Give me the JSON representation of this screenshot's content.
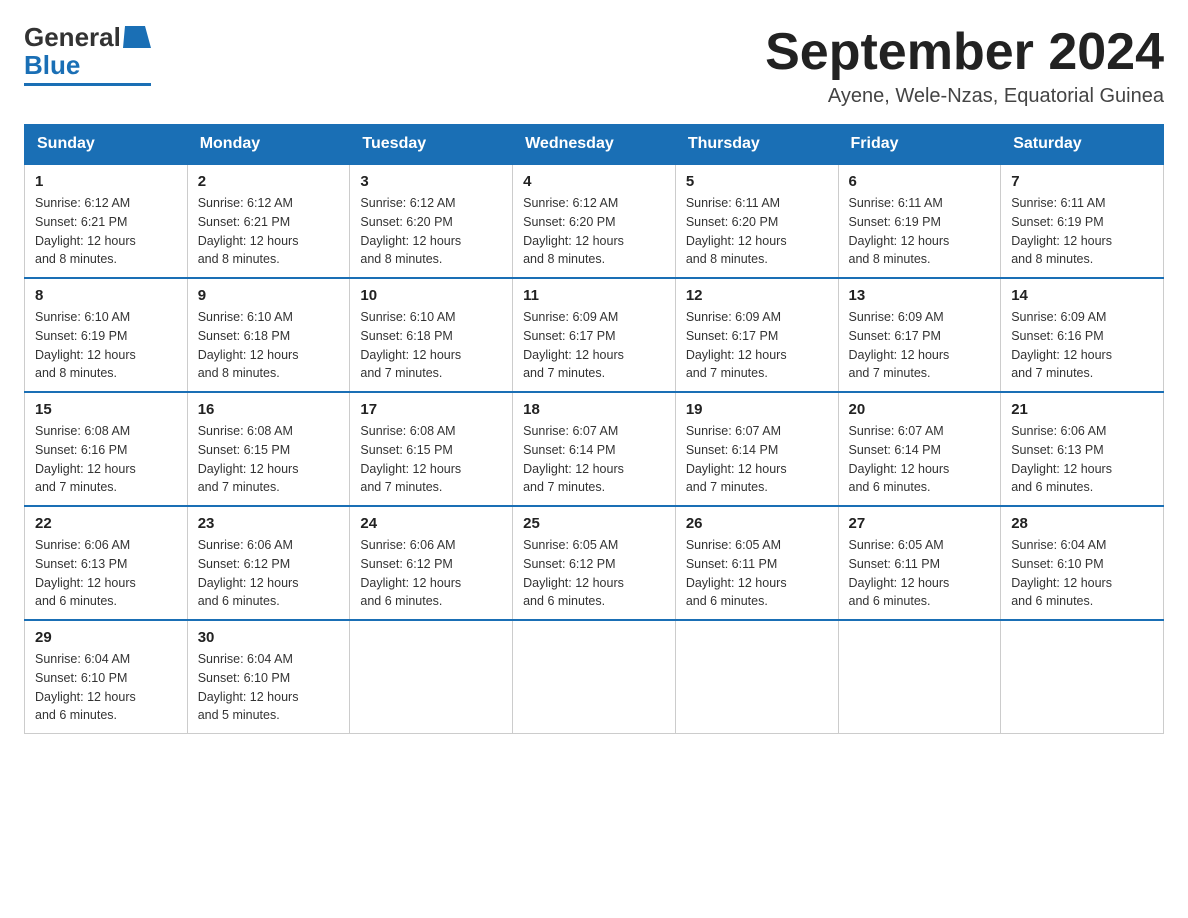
{
  "header": {
    "logo": {
      "text1": "General",
      "text2": "Blue"
    },
    "title": "September 2024",
    "subtitle": "Ayene, Wele-Nzas, Equatorial Guinea"
  },
  "days_of_week": [
    "Sunday",
    "Monday",
    "Tuesday",
    "Wednesday",
    "Thursday",
    "Friday",
    "Saturday"
  ],
  "weeks": [
    [
      {
        "day": "1",
        "sunrise": "6:12 AM",
        "sunset": "6:21 PM",
        "daylight": "12 hours and 8 minutes."
      },
      {
        "day": "2",
        "sunrise": "6:12 AM",
        "sunset": "6:21 PM",
        "daylight": "12 hours and 8 minutes."
      },
      {
        "day": "3",
        "sunrise": "6:12 AM",
        "sunset": "6:20 PM",
        "daylight": "12 hours and 8 minutes."
      },
      {
        "day": "4",
        "sunrise": "6:12 AM",
        "sunset": "6:20 PM",
        "daylight": "12 hours and 8 minutes."
      },
      {
        "day": "5",
        "sunrise": "6:11 AM",
        "sunset": "6:20 PM",
        "daylight": "12 hours and 8 minutes."
      },
      {
        "day": "6",
        "sunrise": "6:11 AM",
        "sunset": "6:19 PM",
        "daylight": "12 hours and 8 minutes."
      },
      {
        "day": "7",
        "sunrise": "6:11 AM",
        "sunset": "6:19 PM",
        "daylight": "12 hours and 8 minutes."
      }
    ],
    [
      {
        "day": "8",
        "sunrise": "6:10 AM",
        "sunset": "6:19 PM",
        "daylight": "12 hours and 8 minutes."
      },
      {
        "day": "9",
        "sunrise": "6:10 AM",
        "sunset": "6:18 PM",
        "daylight": "12 hours and 8 minutes."
      },
      {
        "day": "10",
        "sunrise": "6:10 AM",
        "sunset": "6:18 PM",
        "daylight": "12 hours and 7 minutes."
      },
      {
        "day": "11",
        "sunrise": "6:09 AM",
        "sunset": "6:17 PM",
        "daylight": "12 hours and 7 minutes."
      },
      {
        "day": "12",
        "sunrise": "6:09 AM",
        "sunset": "6:17 PM",
        "daylight": "12 hours and 7 minutes."
      },
      {
        "day": "13",
        "sunrise": "6:09 AM",
        "sunset": "6:17 PM",
        "daylight": "12 hours and 7 minutes."
      },
      {
        "day": "14",
        "sunrise": "6:09 AM",
        "sunset": "6:16 PM",
        "daylight": "12 hours and 7 minutes."
      }
    ],
    [
      {
        "day": "15",
        "sunrise": "6:08 AM",
        "sunset": "6:16 PM",
        "daylight": "12 hours and 7 minutes."
      },
      {
        "day": "16",
        "sunrise": "6:08 AM",
        "sunset": "6:15 PM",
        "daylight": "12 hours and 7 minutes."
      },
      {
        "day": "17",
        "sunrise": "6:08 AM",
        "sunset": "6:15 PM",
        "daylight": "12 hours and 7 minutes."
      },
      {
        "day": "18",
        "sunrise": "6:07 AM",
        "sunset": "6:14 PM",
        "daylight": "12 hours and 7 minutes."
      },
      {
        "day": "19",
        "sunrise": "6:07 AM",
        "sunset": "6:14 PM",
        "daylight": "12 hours and 7 minutes."
      },
      {
        "day": "20",
        "sunrise": "6:07 AM",
        "sunset": "6:14 PM",
        "daylight": "12 hours and 6 minutes."
      },
      {
        "day": "21",
        "sunrise": "6:06 AM",
        "sunset": "6:13 PM",
        "daylight": "12 hours and 6 minutes."
      }
    ],
    [
      {
        "day": "22",
        "sunrise": "6:06 AM",
        "sunset": "6:13 PM",
        "daylight": "12 hours and 6 minutes."
      },
      {
        "day": "23",
        "sunrise": "6:06 AM",
        "sunset": "6:12 PM",
        "daylight": "12 hours and 6 minutes."
      },
      {
        "day": "24",
        "sunrise": "6:06 AM",
        "sunset": "6:12 PM",
        "daylight": "12 hours and 6 minutes."
      },
      {
        "day": "25",
        "sunrise": "6:05 AM",
        "sunset": "6:12 PM",
        "daylight": "12 hours and 6 minutes."
      },
      {
        "day": "26",
        "sunrise": "6:05 AM",
        "sunset": "6:11 PM",
        "daylight": "12 hours and 6 minutes."
      },
      {
        "day": "27",
        "sunrise": "6:05 AM",
        "sunset": "6:11 PM",
        "daylight": "12 hours and 6 minutes."
      },
      {
        "day": "28",
        "sunrise": "6:04 AM",
        "sunset": "6:10 PM",
        "daylight": "12 hours and 6 minutes."
      }
    ],
    [
      {
        "day": "29",
        "sunrise": "6:04 AM",
        "sunset": "6:10 PM",
        "daylight": "12 hours and 6 minutes."
      },
      {
        "day": "30",
        "sunrise": "6:04 AM",
        "sunset": "6:10 PM",
        "daylight": "12 hours and 5 minutes."
      },
      null,
      null,
      null,
      null,
      null
    ]
  ]
}
